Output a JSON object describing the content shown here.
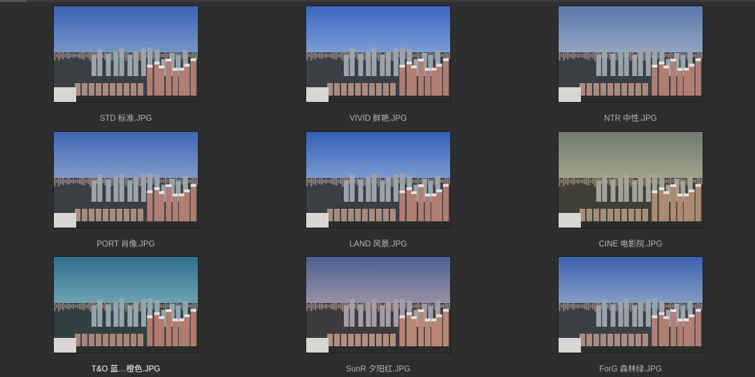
{
  "browser": {
    "files": [
      {
        "name": "STD 标准.JPG",
        "sky_top": "#3b63b6",
        "sky_bottom": "#7b9ac8",
        "tint": "none",
        "selected": false
      },
      {
        "name": "VIVID 鲜艳.JPG",
        "sky_top": "#3a66c2",
        "sky_bottom": "#80a2d4",
        "tint": "none",
        "selected": false
      },
      {
        "name": "NTR 中性.JPG",
        "sky_top": "#5a78ad",
        "sky_bottom": "#97a9c4",
        "tint": "none",
        "selected": false
      },
      {
        "name": "PORT 肖像.JPG",
        "sky_top": "#4167b8",
        "sky_bottom": "#859fca",
        "tint": "none",
        "selected": false
      },
      {
        "name": "LAND 风景.JPG",
        "sky_top": "#3460b8",
        "sky_bottom": "#7fa0d3",
        "tint": "none",
        "selected": false
      },
      {
        "name": "CINE 电影院.JPG",
        "sky_top": "#6f7c6d",
        "sky_bottom": "#a3a58e",
        "tint": "cine",
        "selected": false
      },
      {
        "name": "T&O 蓝…橙色.JPG",
        "sky_top": "#2f6f8e",
        "sky_bottom": "#73a7b6",
        "tint": "teal",
        "selected": true
      },
      {
        "name": "SunR 夕阳红.JPG",
        "sky_top": "#4e5f93",
        "sky_bottom": "#9c96a6",
        "tint": "warm",
        "selected": false
      },
      {
        "name": "ForG 森林绿.JPG",
        "sky_top": "#3d63b0",
        "sky_bottom": "#89a2c6",
        "tint": "none",
        "selected": false
      }
    ]
  }
}
